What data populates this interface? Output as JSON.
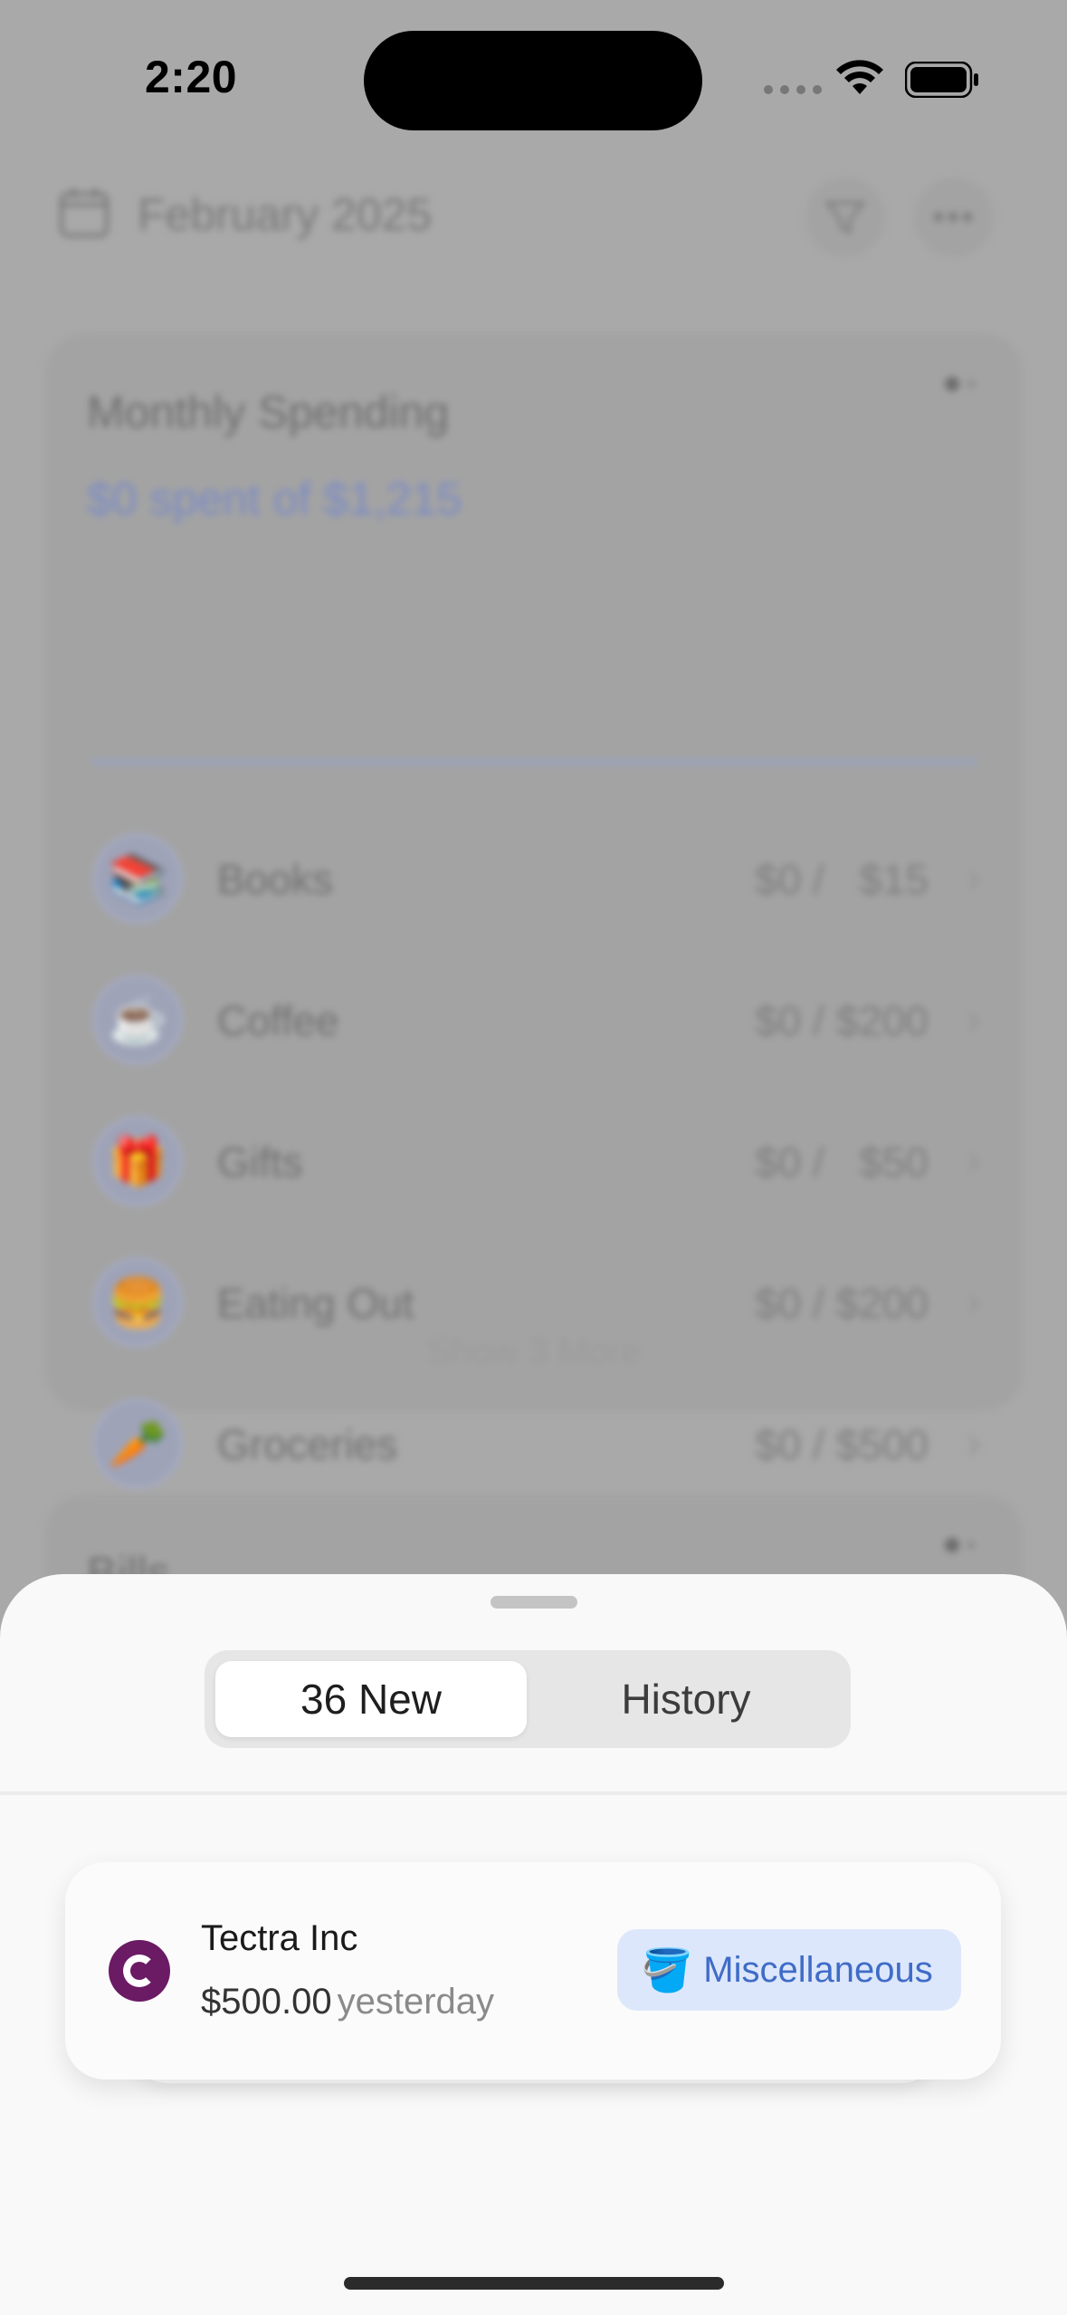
{
  "status_bar": {
    "time": "2:20"
  },
  "header": {
    "month": "February 2025"
  },
  "spending": {
    "title": "Monthly Spending",
    "summary": "$0 spent of $1,215",
    "progress": 0,
    "categories": [
      {
        "name": "Books",
        "emoji": "📚",
        "amount": "$0 /   $15"
      },
      {
        "name": "Coffee",
        "emoji": "☕",
        "amount": "$0 / $200"
      },
      {
        "name": "Gifts",
        "emoji": "🎁",
        "amount": "$0 /   $50"
      },
      {
        "name": "Eating Out",
        "emoji": "🍔",
        "amount": "$0 / $200"
      },
      {
        "name": "Groceries",
        "emoji": "🥕",
        "amount": "$0 / $500"
      }
    ],
    "show_more": "Show 3 More"
  },
  "bills": {
    "title": "Bills"
  },
  "sheet": {
    "tabs": [
      {
        "label": "36 New"
      },
      {
        "label": "History"
      }
    ],
    "transaction": {
      "merchant": "Tectra Inc",
      "amount": "$500.00",
      "date": "yesterday",
      "category": "Miscellaneous",
      "category_icon": "🪣"
    }
  },
  "colors": {
    "accent": "#3f6cc7",
    "pill_bg": "#dde7fb",
    "merchant_logo": "#6b1a64"
  }
}
